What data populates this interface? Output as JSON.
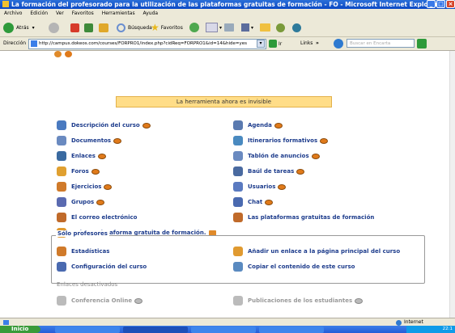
{
  "window": {
    "title": "La formación del profesorado para la utilización de las plataformas gratuitas de formación - FO - Microsoft Internet Explorer"
  },
  "menubar": [
    "Archivo",
    "Edición",
    "Ver",
    "Favoritos",
    "Herramientas",
    "Ayuda"
  ],
  "toolbar": {
    "back_label": "Atrás",
    "search_label": "Búsqueda",
    "favorites_label": "Favoritos"
  },
  "address": {
    "label": "Dirección",
    "url": "http://campus.dokeos.com/courses/FORPRO1/index.php?cidReq=FORPRO1&id=14&hide=yes",
    "go_label": "Ir",
    "links_label": "Links",
    "search_placeholder": "Buscar en Encarta"
  },
  "notice": "La herramienta ahora es invisible",
  "tools_left": [
    "Descripción del curso",
    "Documentos",
    "Enlaces",
    "Foros",
    "Ejercicios",
    "Grupos",
    "El correo electrónico",
    "Dokeos.Plataforma gratuita de formación."
  ],
  "tools_right": [
    "Agenda",
    "Itinerarios formativos",
    "Tablón de anuncios",
    "Baúl de tareas",
    "Usuarios",
    "Chat",
    "Las plataformas gratuitas de formación"
  ],
  "teachers": {
    "legend": "Sólo profesores",
    "items": [
      "Estadísticas",
      "Añadir un enlace a la página principal del curso",
      "Configuración del curso",
      "Copiar el contenido de este curso"
    ]
  },
  "disabled": {
    "label": "Enlaces desactivados",
    "items": [
      "Conferencia Online",
      "Publicaciones de los estudiantes"
    ]
  },
  "status": {
    "zone": "Internet"
  },
  "taskbar": {
    "start_label": "Inicio",
    "clock": "22:1"
  }
}
